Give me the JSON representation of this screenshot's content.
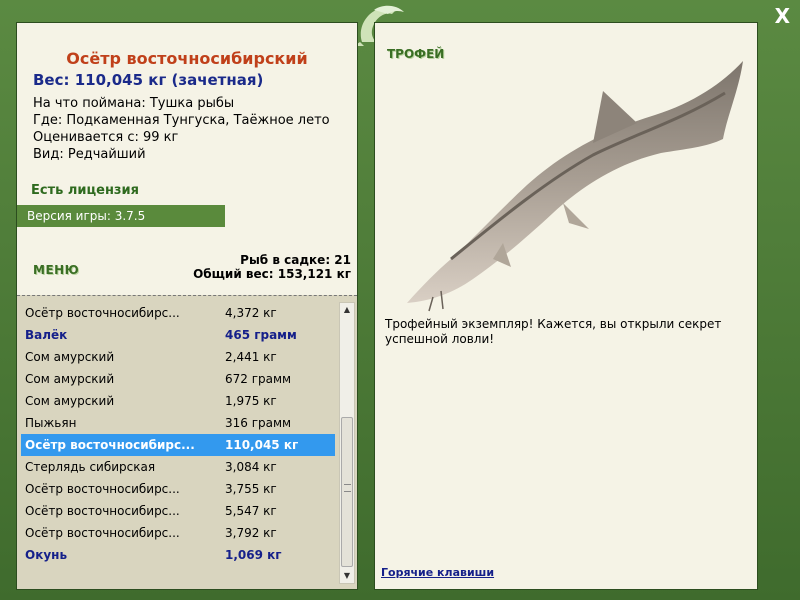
{
  "window": {
    "close_label": "X"
  },
  "fish": {
    "title": "Осётр восточносибирский",
    "weight_line": "Вес: 110,045 кг (зачетная)",
    "caught_on": "На что поймана: Тушка рыбы",
    "where": "Где: Подкаменная Тунгуска, Таёжное лето",
    "valued_from": "Оценивается с: 99 кг",
    "kind": "Вид: Редчайший"
  },
  "license_label": "Есть лицензия",
  "version_label": "Версия игры: 3.7.5",
  "menu_label": "МЕНЮ",
  "stats": {
    "fish_in_keepnet": "Рыб в садке: 21",
    "total_weight": "Общий вес: 153,121 кг"
  },
  "catch_list": [
    {
      "name": "Осётр восточносибирс...",
      "weight": "4,372 кг",
      "style": "normal"
    },
    {
      "name": "Валёк",
      "weight": "465 грамм",
      "style": "trophy"
    },
    {
      "name": "Сом амурский",
      "weight": "2,441 кг",
      "style": "normal"
    },
    {
      "name": "Сом амурский",
      "weight": "672 грамм",
      "style": "normal"
    },
    {
      "name": "Сом амурский",
      "weight": "1,975 кг",
      "style": "normal"
    },
    {
      "name": "Пыжьян",
      "weight": "316 грамм",
      "style": "normal"
    },
    {
      "name": "Осётр восточносибирс...",
      "weight": "110,045 кг",
      "style": "selected"
    },
    {
      "name": "Стерлядь сибирская",
      "weight": "3,084 кг",
      "style": "normal"
    },
    {
      "name": "Осётр восточносибирс...",
      "weight": "3,755 кг",
      "style": "normal"
    },
    {
      "name": "Осётр восточносибирс...",
      "weight": "5,547 кг",
      "style": "normal"
    },
    {
      "name": "Осётр восточносибирс...",
      "weight": "3,792 кг",
      "style": "normal"
    },
    {
      "name": "Окунь",
      "weight": "1,069 кг",
      "style": "trophy"
    }
  ],
  "right": {
    "trophy_label": "ТРОФЕЙ",
    "description": "Трофейный экземпляр! Кажется, вы открыли секрет успешной ловли!",
    "hotkeys_link": "Горячие клавиши"
  },
  "icons": {
    "logo": "fish-logo-icon",
    "scroll_up": "arrow-up-icon",
    "scroll_down": "arrow-down-icon"
  },
  "colors": {
    "frame": "#4a7a36",
    "panel": "#f5f3e6",
    "list_bg": "#d9d5bf",
    "title": "#c0401a",
    "trophy_text": "#15208a",
    "selected_row": "#3399ee"
  }
}
